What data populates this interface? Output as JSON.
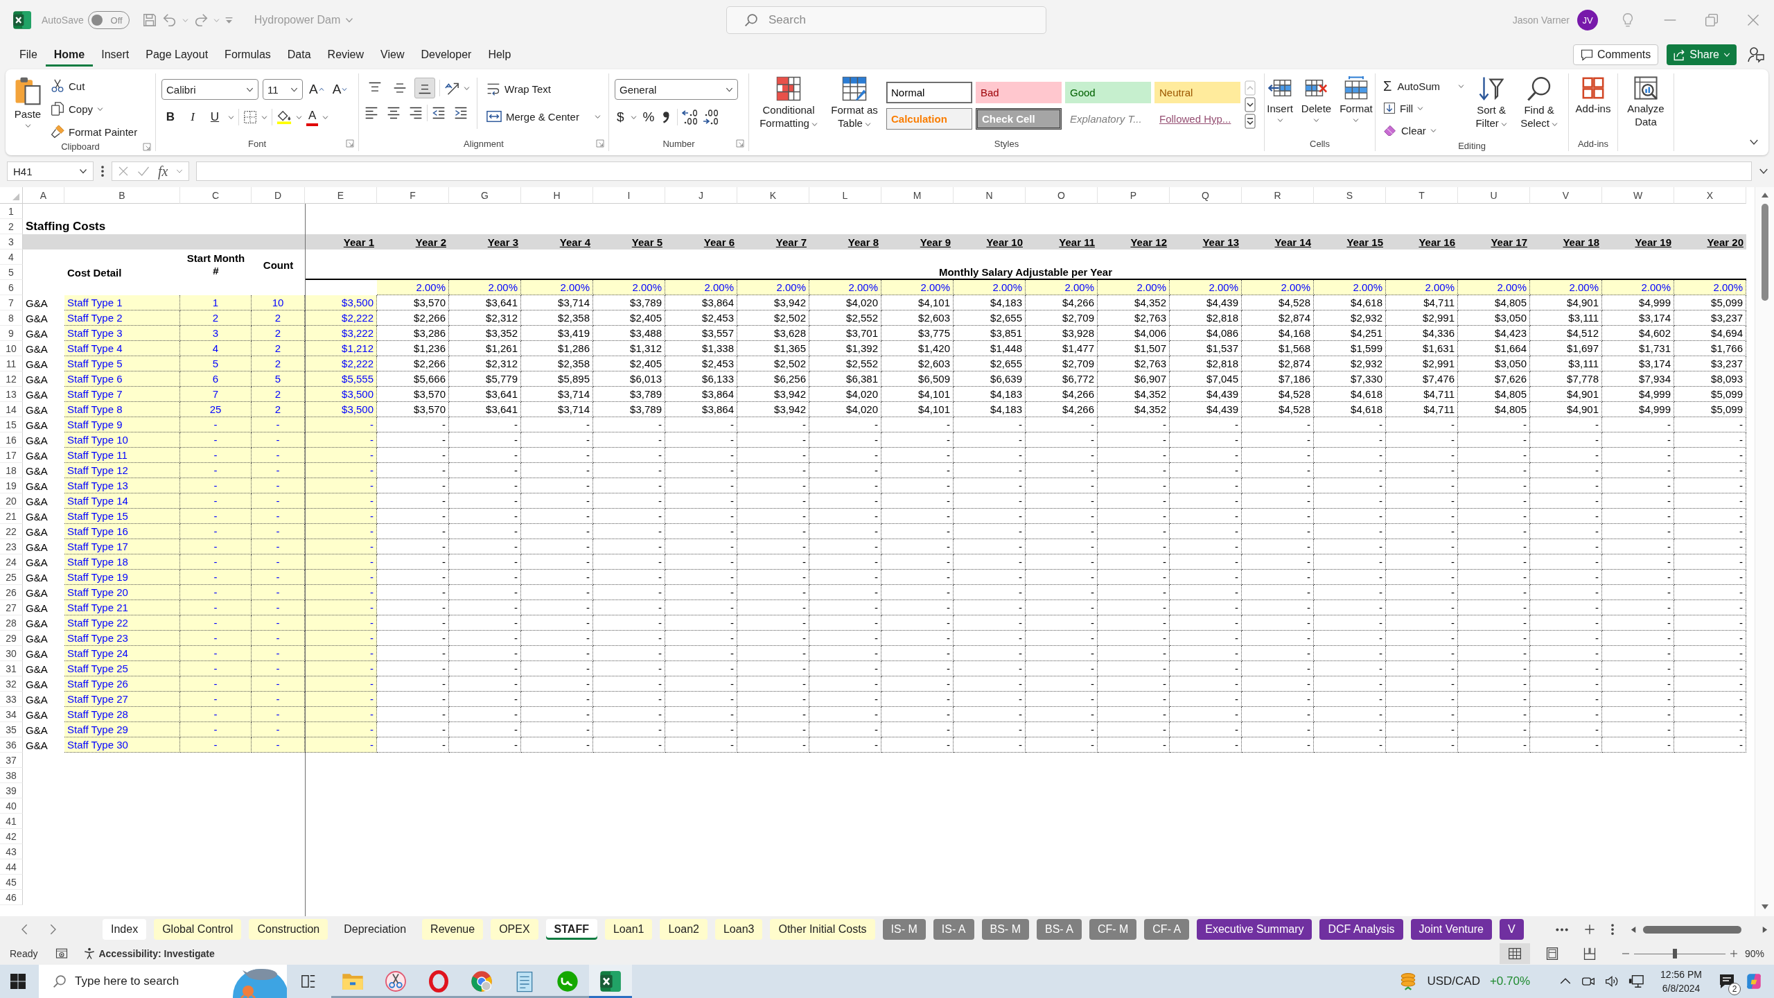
{
  "title_bar": {
    "autosave": {
      "label": "AutoSave",
      "state_text": "Off",
      "on": false
    },
    "document_title": "Hydropower Dam",
    "search": {
      "placeholder": "Search"
    },
    "user_name": "Jason Varner",
    "avatar_initials": "JV"
  },
  "menu_tabs": [
    {
      "label": "File",
      "selected": false
    },
    {
      "label": "Home",
      "selected": true
    },
    {
      "label": "Insert",
      "selected": false
    },
    {
      "label": "Page Layout",
      "selected": false
    },
    {
      "label": "Formulas",
      "selected": false
    },
    {
      "label": "Data",
      "selected": false
    },
    {
      "label": "Review",
      "selected": false
    },
    {
      "label": "View",
      "selected": false
    },
    {
      "label": "Developer",
      "selected": false
    },
    {
      "label": "Help",
      "selected": false
    }
  ],
  "ribbon_actions": {
    "comments": "Comments",
    "share": "Share"
  },
  "ribbon": {
    "clipboard": {
      "label": "Clipboard",
      "paste": "Paste",
      "cut": "Cut",
      "copy": "Copy",
      "format_painter": "Format Painter"
    },
    "font": {
      "label": "Font",
      "font_name": "Calibri",
      "font_size": "11",
      "grow_font": "A",
      "shrink_font": "A",
      "bold": "B",
      "italic": "I",
      "underline": "U",
      "font_color": "A"
    },
    "alignment": {
      "label": "Alignment",
      "align_buttons": [
        {
          "kind": "top",
          "selected": false
        },
        {
          "kind": "middle",
          "selected": false
        },
        {
          "kind": "bottom",
          "selected": true
        }
      ],
      "wrap_text": "Wrap Text",
      "merge_center": "Merge & Center"
    },
    "number": {
      "label": "Number",
      "format": "General",
      "currency": "$",
      "percent": "%"
    },
    "styles": {
      "label": "Styles",
      "conditional_formatting": "Conditional Formatting",
      "format_as_table": "Format as Table",
      "gallery": [
        {
          "label": "Normal",
          "kind": "normal",
          "selected": true
        },
        {
          "label": "Bad",
          "kind": "bad",
          "selected": false
        },
        {
          "label": "Good",
          "kind": "good",
          "selected": false
        },
        {
          "label": "Neutral",
          "kind": "neutral",
          "selected": false
        },
        {
          "label": "Calculation",
          "kind": "calculation",
          "selected": false
        },
        {
          "label": "Check Cell",
          "kind": "check",
          "selected": false
        },
        {
          "label": "Explanatory T...",
          "kind": "explanatory",
          "selected": false
        },
        {
          "label": "Followed Hyp...",
          "kind": "followed_link",
          "selected": false
        }
      ]
    },
    "cells": {
      "label": "Cells",
      "insert": "Insert",
      "delete": "Delete",
      "format": "Format"
    },
    "editing": {
      "label": "Editing",
      "autosum_symbol": "Σ",
      "autosum": "AutoSum",
      "fill": "Fill",
      "clear": "Clear",
      "sort_filter": "Sort & Filter",
      "find_select": "Find & Select"
    },
    "addins": {
      "label": "Add-ins",
      "addins": "Add-ins",
      "analyze_data": "Analyze Data"
    }
  },
  "formula_bar": {
    "name_box": "H41",
    "function_label": "fx"
  },
  "sheet": {
    "columns": [
      "A",
      "B",
      "C",
      "D",
      "E",
      "F",
      "G",
      "H",
      "I",
      "J",
      "K",
      "L",
      "M",
      "N",
      "O",
      "P",
      "Q",
      "R",
      "S",
      "T",
      "U",
      "V",
      "W",
      "X"
    ],
    "row_numbers": [
      "1",
      "2",
      "3",
      "4",
      "5",
      "6",
      "7",
      "8",
      "9",
      "10",
      "11",
      "12",
      "13",
      "14",
      "15",
      "16",
      "17",
      "18",
      "19",
      "20",
      "21",
      "22",
      "23",
      "24",
      "25",
      "26",
      "27",
      "28",
      "29",
      "30",
      "31",
      "32",
      "33",
      "34",
      "35",
      "36",
      "37",
      "38",
      "39",
      "40",
      "41",
      "42",
      "43",
      "44",
      "45",
      "46"
    ],
    "title": "Staffing Costs",
    "year_headers": [
      "Year 1",
      "Year 2",
      "Year 3",
      "Year 4",
      "Year 5",
      "Year 6",
      "Year 7",
      "Year 8",
      "Year 9",
      "Year 10",
      "Year 11",
      "Year 12",
      "Year 13",
      "Year 14",
      "Year 15",
      "Year 16",
      "Year 17",
      "Year 18",
      "Year 19",
      "Year 20"
    ],
    "cost_detail_header": "Cost Detail",
    "start_month_header": "Start Month #",
    "count_header": "Count",
    "salary_band": "Monthly Salary Adjustable per Year",
    "growth_rates": [
      "2.00%",
      "2.00%",
      "2.00%",
      "2.00%",
      "2.00%",
      "2.00%",
      "2.00%",
      "2.00%",
      "2.00%",
      "2.00%",
      "2.00%",
      "2.00%",
      "2.00%",
      "2.00%",
      "2.00%",
      "2.00%",
      "2.00%",
      "2.00%",
      "2.00%"
    ],
    "rows": [
      {
        "category": "G&A",
        "name": "Staff Type 1",
        "start_month": "1",
        "count": "10",
        "base": "$3,500",
        "values": [
          "$3,570",
          "$3,641",
          "$3,714",
          "$3,789",
          "$3,864",
          "$3,942",
          "$4,020",
          "$4,101",
          "$4,183",
          "$4,266",
          "$4,352",
          "$4,439",
          "$4,528",
          "$4,618",
          "$4,711",
          "$4,805",
          "$4,901",
          "$4,999",
          "$5,099"
        ]
      },
      {
        "category": "G&A",
        "name": "Staff Type 2",
        "start_month": "2",
        "count": "2",
        "base": "$2,222",
        "values": [
          "$2,266",
          "$2,312",
          "$2,358",
          "$2,405",
          "$2,453",
          "$2,502",
          "$2,552",
          "$2,603",
          "$2,655",
          "$2,709",
          "$2,763",
          "$2,818",
          "$2,874",
          "$2,932",
          "$2,991",
          "$3,050",
          "$3,111",
          "$3,174",
          "$3,237"
        ]
      },
      {
        "category": "G&A",
        "name": "Staff Type 3",
        "start_month": "3",
        "count": "2",
        "base": "$3,222",
        "values": [
          "$3,286",
          "$3,352",
          "$3,419",
          "$3,488",
          "$3,557",
          "$3,628",
          "$3,701",
          "$3,775",
          "$3,851",
          "$3,928",
          "$4,006",
          "$4,086",
          "$4,168",
          "$4,251",
          "$4,336",
          "$4,423",
          "$4,512",
          "$4,602",
          "$4,694"
        ]
      },
      {
        "category": "G&A",
        "name": "Staff Type 4",
        "start_month": "4",
        "count": "2",
        "base": "$1,212",
        "values": [
          "$1,236",
          "$1,261",
          "$1,286",
          "$1,312",
          "$1,338",
          "$1,365",
          "$1,392",
          "$1,420",
          "$1,448",
          "$1,477",
          "$1,507",
          "$1,537",
          "$1,568",
          "$1,599",
          "$1,631",
          "$1,664",
          "$1,697",
          "$1,731",
          "$1,766"
        ]
      },
      {
        "category": "G&A",
        "name": "Staff Type 5",
        "start_month": "5",
        "count": "2",
        "base": "$2,222",
        "values": [
          "$2,266",
          "$2,312",
          "$2,358",
          "$2,405",
          "$2,453",
          "$2,502",
          "$2,552",
          "$2,603",
          "$2,655",
          "$2,709",
          "$2,763",
          "$2,818",
          "$2,874",
          "$2,932",
          "$2,991",
          "$3,050",
          "$3,111",
          "$3,174",
          "$3,237"
        ]
      },
      {
        "category": "G&A",
        "name": "Staff Type 6",
        "start_month": "6",
        "count": "5",
        "base": "$5,555",
        "values": [
          "$5,666",
          "$5,779",
          "$5,895",
          "$6,013",
          "$6,133",
          "$6,256",
          "$6,381",
          "$6,509",
          "$6,639",
          "$6,772",
          "$6,907",
          "$7,045",
          "$7,186",
          "$7,330",
          "$7,476",
          "$7,626",
          "$7,778",
          "$7,934",
          "$8,093"
        ]
      },
      {
        "category": "G&A",
        "name": "Staff Type 7",
        "start_month": "7",
        "count": "2",
        "base": "$3,500",
        "values": [
          "$3,570",
          "$3,641",
          "$3,714",
          "$3,789",
          "$3,864",
          "$3,942",
          "$4,020",
          "$4,101",
          "$4,183",
          "$4,266",
          "$4,352",
          "$4,439",
          "$4,528",
          "$4,618",
          "$4,711",
          "$4,805",
          "$4,901",
          "$4,999",
          "$5,099"
        ]
      },
      {
        "category": "G&A",
        "name": "Staff Type 8",
        "start_month": "25",
        "count": "2",
        "base": "$3,500",
        "values": [
          "$3,570",
          "$3,641",
          "$3,714",
          "$3,789",
          "$3,864",
          "$3,942",
          "$4,020",
          "$4,101",
          "$4,183",
          "$4,266",
          "$4,352",
          "$4,439",
          "$4,528",
          "$4,618",
          "$4,711",
          "$4,805",
          "$4,901",
          "$4,999",
          "$5,099"
        ]
      },
      {
        "category": "G&A",
        "name": "Staff Type 9",
        "start_month": "-",
        "count": "-",
        "base": "-",
        "values": [
          "-",
          "-",
          "-",
          "-",
          "-",
          "-",
          "-",
          "-",
          "-",
          "-",
          "-",
          "-",
          "-",
          "-",
          "-",
          "-",
          "-",
          "-",
          "-"
        ]
      },
      {
        "category": "G&A",
        "name": "Staff Type 10",
        "start_month": "-",
        "count": "-",
        "base": "-",
        "values": [
          "-",
          "-",
          "-",
          "-",
          "-",
          "-",
          "-",
          "-",
          "-",
          "-",
          "-",
          "-",
          "-",
          "-",
          "-",
          "-",
          "-",
          "-",
          "-"
        ]
      },
      {
        "category": "G&A",
        "name": "Staff Type 11",
        "start_month": "-",
        "count": "-",
        "base": "-",
        "values": [
          "-",
          "-",
          "-",
          "-",
          "-",
          "-",
          "-",
          "-",
          "-",
          "-",
          "-",
          "-",
          "-",
          "-",
          "-",
          "-",
          "-",
          "-",
          "-"
        ]
      },
      {
        "category": "G&A",
        "name": "Staff Type 12",
        "start_month": "-",
        "count": "-",
        "base": "-",
        "values": [
          "-",
          "-",
          "-",
          "-",
          "-",
          "-",
          "-",
          "-",
          "-",
          "-",
          "-",
          "-",
          "-",
          "-",
          "-",
          "-",
          "-",
          "-",
          "-"
        ]
      },
      {
        "category": "G&A",
        "name": "Staff Type 13",
        "start_month": "-",
        "count": "-",
        "base": "-",
        "values": [
          "-",
          "-",
          "-",
          "-",
          "-",
          "-",
          "-",
          "-",
          "-",
          "-",
          "-",
          "-",
          "-",
          "-",
          "-",
          "-",
          "-",
          "-",
          "-"
        ]
      },
      {
        "category": "G&A",
        "name": "Staff Type 14",
        "start_month": "-",
        "count": "-",
        "base": "-",
        "values": [
          "-",
          "-",
          "-",
          "-",
          "-",
          "-",
          "-",
          "-",
          "-",
          "-",
          "-",
          "-",
          "-",
          "-",
          "-",
          "-",
          "-",
          "-",
          "-"
        ]
      },
      {
        "category": "G&A",
        "name": "Staff Type 15",
        "start_month": "-",
        "count": "-",
        "base": "-",
        "values": [
          "-",
          "-",
          "-",
          "-",
          "-",
          "-",
          "-",
          "-",
          "-",
          "-",
          "-",
          "-",
          "-",
          "-",
          "-",
          "-",
          "-",
          "-",
          "-"
        ]
      },
      {
        "category": "G&A",
        "name": "Staff Type 16",
        "start_month": "-",
        "count": "-",
        "base": "-",
        "values": [
          "-",
          "-",
          "-",
          "-",
          "-",
          "-",
          "-",
          "-",
          "-",
          "-",
          "-",
          "-",
          "-",
          "-",
          "-",
          "-",
          "-",
          "-",
          "-"
        ]
      },
      {
        "category": "G&A",
        "name": "Staff Type 17",
        "start_month": "-",
        "count": "-",
        "base": "-",
        "values": [
          "-",
          "-",
          "-",
          "-",
          "-",
          "-",
          "-",
          "-",
          "-",
          "-",
          "-",
          "-",
          "-",
          "-",
          "-",
          "-",
          "-",
          "-",
          "-"
        ]
      },
      {
        "category": "G&A",
        "name": "Staff Type 18",
        "start_month": "-",
        "count": "-",
        "base": "-",
        "values": [
          "-",
          "-",
          "-",
          "-",
          "-",
          "-",
          "-",
          "-",
          "-",
          "-",
          "-",
          "-",
          "-",
          "-",
          "-",
          "-",
          "-",
          "-",
          "-"
        ]
      },
      {
        "category": "G&A",
        "name": "Staff Type 19",
        "start_month": "-",
        "count": "-",
        "base": "-",
        "values": [
          "-",
          "-",
          "-",
          "-",
          "-",
          "-",
          "-",
          "-",
          "-",
          "-",
          "-",
          "-",
          "-",
          "-",
          "-",
          "-",
          "-",
          "-",
          "-"
        ]
      },
      {
        "category": "G&A",
        "name": "Staff Type 20",
        "start_month": "-",
        "count": "-",
        "base": "-",
        "values": [
          "-",
          "-",
          "-",
          "-",
          "-",
          "-",
          "-",
          "-",
          "-",
          "-",
          "-",
          "-",
          "-",
          "-",
          "-",
          "-",
          "-",
          "-",
          "-"
        ]
      },
      {
        "category": "G&A",
        "name": "Staff Type 21",
        "start_month": "-",
        "count": "-",
        "base": "-",
        "values": [
          "-",
          "-",
          "-",
          "-",
          "-",
          "-",
          "-",
          "-",
          "-",
          "-",
          "-",
          "-",
          "-",
          "-",
          "-",
          "-",
          "-",
          "-",
          "-"
        ]
      },
      {
        "category": "G&A",
        "name": "Staff Type 22",
        "start_month": "-",
        "count": "-",
        "base": "-",
        "values": [
          "-",
          "-",
          "-",
          "-",
          "-",
          "-",
          "-",
          "-",
          "-",
          "-",
          "-",
          "-",
          "-",
          "-",
          "-",
          "-",
          "-",
          "-",
          "-"
        ]
      },
      {
        "category": "G&A",
        "name": "Staff Type 23",
        "start_month": "-",
        "count": "-",
        "base": "-",
        "values": [
          "-",
          "-",
          "-",
          "-",
          "-",
          "-",
          "-",
          "-",
          "-",
          "-",
          "-",
          "-",
          "-",
          "-",
          "-",
          "-",
          "-",
          "-",
          "-"
        ]
      },
      {
        "category": "G&A",
        "name": "Staff Type 24",
        "start_month": "-",
        "count": "-",
        "base": "-",
        "values": [
          "-",
          "-",
          "-",
          "-",
          "-",
          "-",
          "-",
          "-",
          "-",
          "-",
          "-",
          "-",
          "-",
          "-",
          "-",
          "-",
          "-",
          "-",
          "-"
        ]
      },
      {
        "category": "G&A",
        "name": "Staff Type 25",
        "start_month": "-",
        "count": "-",
        "base": "-",
        "values": [
          "-",
          "-",
          "-",
          "-",
          "-",
          "-",
          "-",
          "-",
          "-",
          "-",
          "-",
          "-",
          "-",
          "-",
          "-",
          "-",
          "-",
          "-",
          "-"
        ]
      },
      {
        "category": "G&A",
        "name": "Staff Type 26",
        "start_month": "-",
        "count": "-",
        "base": "-",
        "values": [
          "-",
          "-",
          "-",
          "-",
          "-",
          "-",
          "-",
          "-",
          "-",
          "-",
          "-",
          "-",
          "-",
          "-",
          "-",
          "-",
          "-",
          "-",
          "-"
        ]
      },
      {
        "category": "G&A",
        "name": "Staff Type 27",
        "start_month": "-",
        "count": "-",
        "base": "-",
        "values": [
          "-",
          "-",
          "-",
          "-",
          "-",
          "-",
          "-",
          "-",
          "-",
          "-",
          "-",
          "-",
          "-",
          "-",
          "-",
          "-",
          "-",
          "-",
          "-"
        ]
      },
      {
        "category": "G&A",
        "name": "Staff Type 28",
        "start_month": "-",
        "count": "-",
        "base": "-",
        "values": [
          "-",
          "-",
          "-",
          "-",
          "-",
          "-",
          "-",
          "-",
          "-",
          "-",
          "-",
          "-",
          "-",
          "-",
          "-",
          "-",
          "-",
          "-",
          "-"
        ]
      },
      {
        "category": "G&A",
        "name": "Staff Type 29",
        "start_month": "-",
        "count": "-",
        "base": "-",
        "values": [
          "-",
          "-",
          "-",
          "-",
          "-",
          "-",
          "-",
          "-",
          "-",
          "-",
          "-",
          "-",
          "-",
          "-",
          "-",
          "-",
          "-",
          "-",
          "-"
        ]
      },
      {
        "category": "G&A",
        "name": "Staff Type 30",
        "start_month": "-",
        "count": "-",
        "base": "-",
        "values": [
          "-",
          "-",
          "-",
          "-",
          "-",
          "-",
          "-",
          "-",
          "-",
          "-",
          "-",
          "-",
          "-",
          "-",
          "-",
          "-",
          "-",
          "-",
          "-"
        ]
      }
    ]
  },
  "sheet_tabs": [
    {
      "label": "Index",
      "selected": false,
      "color": "#ffffff"
    },
    {
      "label": "Global Control",
      "selected": false,
      "color": "#fffccc"
    },
    {
      "label": "Construction",
      "selected": false,
      "color": "#fffccc"
    },
    {
      "label": "Depreciation",
      "selected": false
    },
    {
      "label": "Revenue",
      "selected": false,
      "color": "#fffccc"
    },
    {
      "label": "OPEX",
      "selected": false,
      "color": "#fffccc"
    },
    {
      "label": "STAFF",
      "selected": true
    },
    {
      "label": "Loan1",
      "selected": false,
      "color": "#fffccc"
    },
    {
      "label": "Loan2",
      "selected": false,
      "color": "#fffccc"
    },
    {
      "label": "Loan3",
      "selected": false,
      "color": "#fffccc"
    },
    {
      "label": "Other Initial Costs",
      "selected": false,
      "color": "#fffccc"
    },
    {
      "label": "IS- M",
      "selected": false,
      "color": "#808080"
    },
    {
      "label": "IS- A",
      "selected": false,
      "color": "#808080"
    },
    {
      "label": "BS- M",
      "selected": false,
      "color": "#808080"
    },
    {
      "label": "BS- A",
      "selected": false,
      "color": "#808080"
    },
    {
      "label": "CF- M",
      "selected": false,
      "color": "#808080"
    },
    {
      "label": "CF- A",
      "selected": false,
      "color": "#808080"
    },
    {
      "label": "Executive Summary",
      "selected": false,
      "color": "#7030a0"
    },
    {
      "label": "DCF Analysis",
      "selected": false,
      "color": "#7030a0"
    },
    {
      "label": "Joint Venture",
      "selected": false,
      "color": "#7030a0"
    },
    {
      "label": "V",
      "selected": false,
      "color": "#7030a0"
    }
  ],
  "status_bar": {
    "status": "Ready",
    "accessibility": "Accessibility: Investigate",
    "view_modes": [
      {
        "kind": "normal",
        "selected": true
      },
      {
        "kind": "page_layout",
        "selected": false
      },
      {
        "kind": "page_break",
        "selected": false
      }
    ],
    "zoom": {
      "level": 0.45,
      "reading": "90%"
    }
  },
  "taskbar": {
    "search": {
      "placeholder": "Type here to search"
    },
    "apps": [
      {
        "kind": "folder",
        "running": true,
        "selected": false
      },
      {
        "kind": "scissors",
        "running": true,
        "selected": false
      },
      {
        "kind": "ring",
        "running": true,
        "selected": false
      },
      {
        "kind": "browser",
        "running": true,
        "selected": false
      },
      {
        "kind": "notepad",
        "running": true,
        "selected": false
      },
      {
        "kind": "circle",
        "running": true,
        "selected": false
      },
      {
        "kind": "spreadsheet",
        "running": true,
        "selected": true
      }
    ],
    "ticker": {
      "symbol": "USD/CAD",
      "change": "+0.70%"
    },
    "time": "12:56 PM",
    "date": "6/8/2024",
    "notification_count": "2"
  }
}
